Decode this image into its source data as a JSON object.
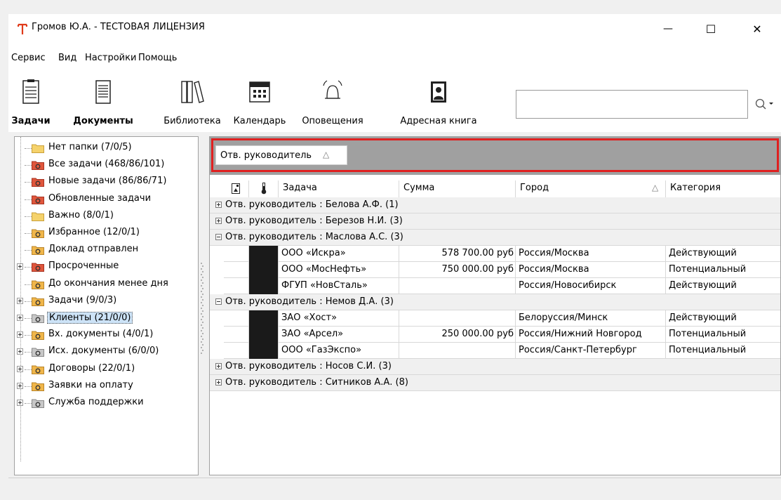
{
  "window": {
    "title": "Громов Ю.А. - ТЕСТОВАЯ ЛИЦЕНЗИЯ",
    "controls": {
      "minimize": "—",
      "maximize": "☐",
      "close": "✕"
    }
  },
  "menu": [
    "Сервис",
    "Вид",
    "Настройки",
    "Помощь"
  ],
  "toolbar": {
    "items": [
      {
        "label": "Задачи",
        "icon": "tasks-icon",
        "bold": true
      },
      {
        "label": "Документы",
        "icon": "documents-icon",
        "bold": true
      },
      {
        "label": "Библиотека",
        "icon": "library-icon",
        "bold": false
      },
      {
        "label": "Календарь",
        "icon": "calendar-icon",
        "bold": false
      },
      {
        "label": "Оповещения",
        "icon": "notifications-icon",
        "bold": false
      },
      {
        "label": "Адресная книга",
        "icon": "address-book-icon",
        "bold": false
      }
    ],
    "search_value": ""
  },
  "tree": [
    {
      "label": "Нет папки (7/0/5)",
      "icon": "folder-yellow",
      "expandable": false
    },
    {
      "label": "Все задачи (468/86/101)",
      "icon": "folder-red",
      "expandable": false
    },
    {
      "label": "Новые задачи (86/86/71)",
      "icon": "folder-red",
      "expandable": false
    },
    {
      "label": "Обновленные задачи",
      "icon": "folder-red",
      "expandable": false
    },
    {
      "label": "Важно (8/0/1)",
      "icon": "folder-yellow",
      "expandable": false
    },
    {
      "label": "Избранное (12/0/1)",
      "icon": "folder-orange",
      "expandable": false
    },
    {
      "label": "Доклад отправлен",
      "icon": "folder-orange",
      "expandable": false
    },
    {
      "label": "Просроченные",
      "icon": "folder-red",
      "expandable": true
    },
    {
      "label": "До окончания менее дня",
      "icon": "folder-orange",
      "expandable": false
    },
    {
      "label": "Задачи (9/0/3)",
      "icon": "folder-orange",
      "expandable": true
    },
    {
      "label": "Клиенты (21/0/0)",
      "icon": "folder-gray",
      "expandable": true,
      "selected": true
    },
    {
      "label": "Вх. документы (4/0/1)",
      "icon": "folder-orange",
      "expandable": true
    },
    {
      "label": "Исх. документы (6/0/0)",
      "icon": "folder-gray",
      "expandable": true
    },
    {
      "label": "Договоры (22/0/1)",
      "icon": "folder-orange",
      "expandable": true
    },
    {
      "label": "Заявки на оплату",
      "icon": "folder-orange",
      "expandable": true
    },
    {
      "label": "Служба поддержки",
      "icon": "folder-gray",
      "expandable": true
    }
  ],
  "group_panel": {
    "chip_label": "Отв. руководитель",
    "chip_sort": "△"
  },
  "grid": {
    "columns": [
      {
        "key": "doc",
        "label": "",
        "icon": "document-column-icon"
      },
      {
        "key": "prio",
        "label": "",
        "icon": "thermometer-column-icon"
      },
      {
        "key": "task",
        "label": "Задача"
      },
      {
        "key": "sum",
        "label": "Сумма"
      },
      {
        "key": "city",
        "label": "Город",
        "sort": "△"
      },
      {
        "key": "cat",
        "label": "Категория"
      }
    ],
    "rows": [
      {
        "type": "group",
        "label": "Отв. руководитель : Белова А.Ф. (1)",
        "expanded": false
      },
      {
        "type": "group",
        "label": "Отв. руководитель : Березов Н.И. (3)",
        "expanded": false
      },
      {
        "type": "group",
        "label": "Отв. руководитель : Маслова А.С. (3)",
        "expanded": true
      },
      {
        "type": "data",
        "task": "ООО «Искра»",
        "sum": "578 700.00 руб",
        "city": "Россия/Москва",
        "cat": "Действующий"
      },
      {
        "type": "data",
        "task": "ООО «МосНефть»",
        "sum": "750 000.00 руб",
        "city": "Россия/Москва",
        "cat": "Потенциальный"
      },
      {
        "type": "data",
        "task": "ФГУП «НовСталь»",
        "sum": "",
        "city": "Россия/Новосибирск",
        "cat": "Действующий"
      },
      {
        "type": "group",
        "label": "Отв. руководитель : Немов Д.А. (3)",
        "expanded": true
      },
      {
        "type": "data",
        "task": "ЗАО «Хост»",
        "sum": "",
        "city": "Белоруссия/Минск",
        "cat": "Действующий"
      },
      {
        "type": "data",
        "task": "ЗАО «Арсел»",
        "sum": "250 000.00 руб",
        "city": "Россия/Нижний Новгород",
        "cat": "Потенциальный"
      },
      {
        "type": "data",
        "task": "ООО «ГазЭкспо»",
        "sum": "",
        "city": "Россия/Санкт-Петербург",
        "cat": "Потенциальный"
      },
      {
        "type": "group",
        "label": "Отв. руководитель : Носов С.И. (3)",
        "expanded": false
      },
      {
        "type": "group",
        "label": "Отв. руководитель : Ситников А.А. (8)",
        "expanded": false
      }
    ]
  },
  "colors": {
    "group_panel_bg": "#a0a0a0",
    "highlight": "#e02020",
    "selection": "#cde3f7",
    "title_icon": "#e03a1a"
  }
}
